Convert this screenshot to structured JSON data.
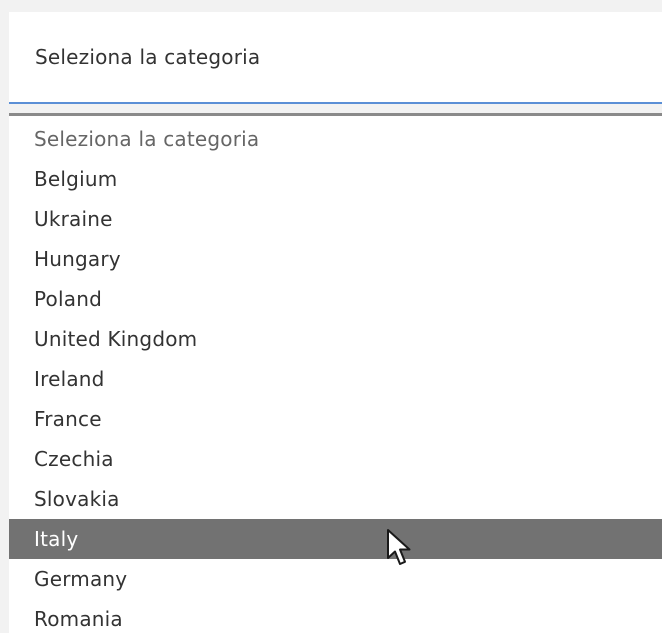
{
  "select": {
    "value": "Seleziona la categoria"
  },
  "dropdown": {
    "options": [
      {
        "label": "Seleziona la categoria",
        "placeholder": true
      },
      {
        "label": "Belgium"
      },
      {
        "label": "Ukraine"
      },
      {
        "label": "Hungary"
      },
      {
        "label": "Poland"
      },
      {
        "label": "United Kingdom"
      },
      {
        "label": "Ireland"
      },
      {
        "label": "France"
      },
      {
        "label": "Czechia"
      },
      {
        "label": "Slovakia"
      },
      {
        "label": "Italy",
        "highlighted": true
      },
      {
        "label": "Germany"
      },
      {
        "label": "Romania"
      }
    ]
  },
  "colors": {
    "focus_underline": "#5b8fd6",
    "highlight_bg": "#727272",
    "text": "#333333"
  }
}
